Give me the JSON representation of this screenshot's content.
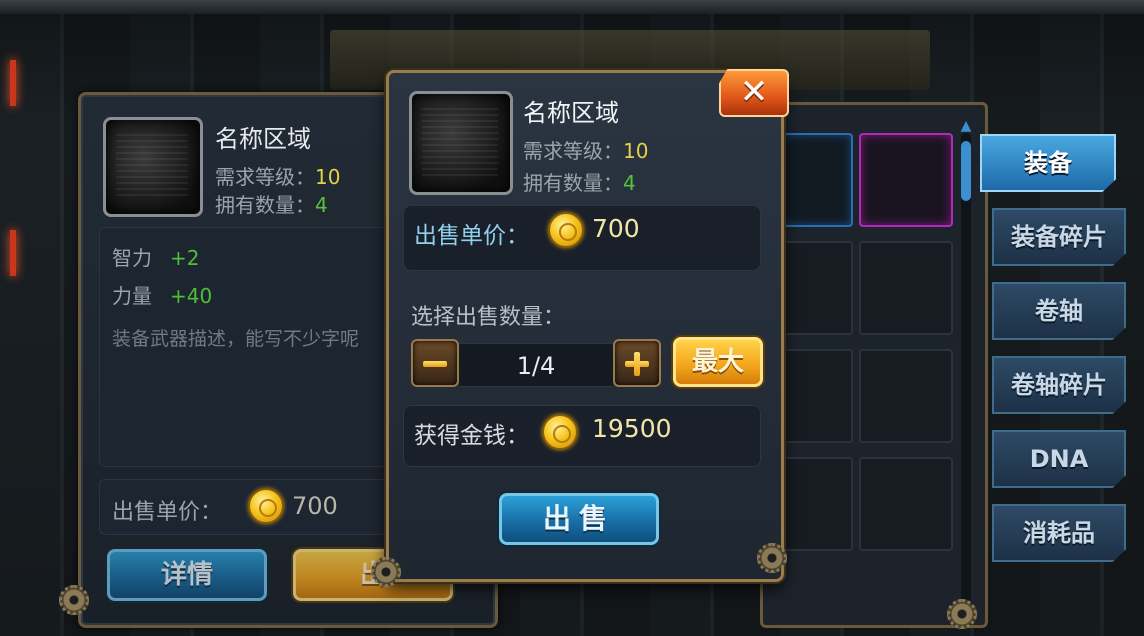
{
  "item": {
    "name": "名称区域",
    "level_label": "需求等级：",
    "level_value": "10",
    "owned_label": "拥有数量：",
    "owned_value": "4"
  },
  "left_panel": {
    "attributes": [
      {
        "name": "智力",
        "value": "+2"
      },
      {
        "name": "力量",
        "value": "+40"
      }
    ],
    "description": "装备武器描述，能写不少字呢",
    "price_label": "出售单价：",
    "price_value": "700",
    "detail_button": "详情",
    "sell_button": "出"
  },
  "dialog": {
    "unit_price_label": "出售单价：",
    "unit_price_value": "700",
    "quantity_label": "选择出售数量：",
    "quantity_value": "1/4",
    "minus_label": "−",
    "plus_label": "+",
    "max_button": "最大",
    "earn_label": "获得金钱：",
    "earn_value": "19500",
    "sell_button": "出售",
    "close_label": "✕"
  },
  "tabs": [
    {
      "label": "装备",
      "active": true
    },
    {
      "label": "装备碎片",
      "active": false
    },
    {
      "label": "卷轴",
      "active": false
    },
    {
      "label": "卷轴碎片",
      "active": false
    },
    {
      "label": "DNA",
      "active": false
    },
    {
      "label": "消耗品",
      "active": false
    }
  ],
  "colors": {
    "accent_blue": "#2aa0d8",
    "accent_gold": "#f5a81d",
    "value_yellow": "#e2d24a",
    "value_green": "#58c23a",
    "close_orange": "#e0561a"
  }
}
